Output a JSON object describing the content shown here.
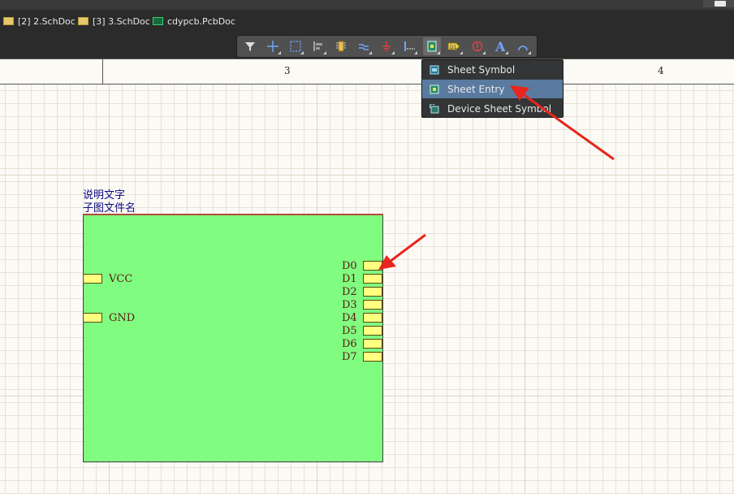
{
  "tabs": [
    {
      "label": "[2] 2.SchDoc",
      "icon": "schematic-doc-icon"
    },
    {
      "label": "[3] 3.SchDoc",
      "icon": "schematic-doc-icon"
    },
    {
      "label": "cdypcb.PcbDoc",
      "icon": "pcb-doc-icon"
    }
  ],
  "toolbar": {
    "buttons": [
      "filter-icon",
      "crosshair-icon",
      "select-rect-icon",
      "align-icon",
      "component-icon",
      "bus-wire-icon",
      "power-port-icon",
      "harness-icon",
      "sheet-symbol-icon",
      "port-icon",
      "no-erc-icon",
      "text-icon",
      "arc-icon"
    ]
  },
  "ruler": {
    "left_label": "3",
    "right_label": "4"
  },
  "dropdown": {
    "items": [
      {
        "label": "Sheet Symbol",
        "icon": "sheet-symbol-icon"
      },
      {
        "label": "Sheet Entry",
        "icon": "sheet-entry-icon"
      },
      {
        "label": "Device Sheet Symbol",
        "icon": "device-sheet-symbol-icon"
      }
    ],
    "selected": "Sheet Entry"
  },
  "sheet_symbol": {
    "designator": "说明文字",
    "filename": "子图文件名",
    "left_entries": [
      "VCC",
      "GND"
    ],
    "right_entries": [
      "D0",
      "D1",
      "D2",
      "D3",
      "D4",
      "D5",
      "D6",
      "D7"
    ]
  },
  "colors": {
    "sheet_fill": "#80fc80",
    "entry_fill": "#ffff80",
    "menu_selected": "#5a7aa0",
    "annotation_arrow": "#e8261e"
  }
}
